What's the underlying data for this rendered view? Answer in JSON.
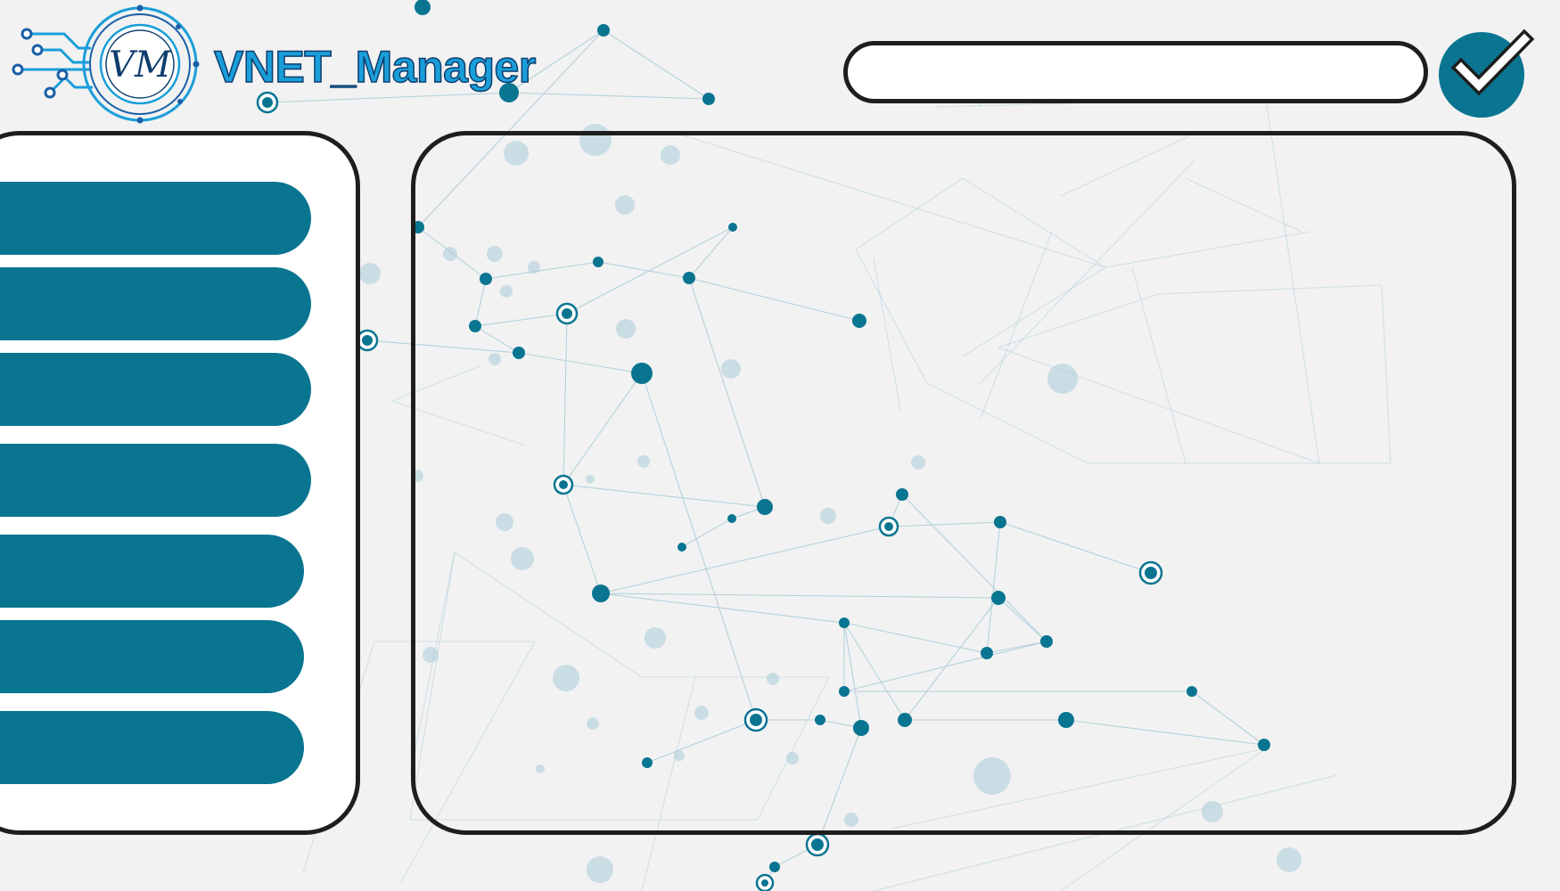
{
  "app": {
    "title": "VNET_Manager",
    "logo_monogram": "VM",
    "accent_color": "#0a7591",
    "logo_text_color": "#1a9ed9",
    "logo_outline_color": "#0f3e6e"
  },
  "header": {
    "search": {
      "value": "",
      "placeholder": ""
    },
    "confirm_button": {
      "icon": "checkmark-icon"
    }
  },
  "sidebar": {
    "items": [
      {
        "label": ""
      },
      {
        "label": ""
      },
      {
        "label": ""
      },
      {
        "label": ""
      },
      {
        "label": ""
      },
      {
        "label": ""
      },
      {
        "label": ""
      }
    ]
  },
  "main": {
    "background_motif": "network-graph"
  }
}
